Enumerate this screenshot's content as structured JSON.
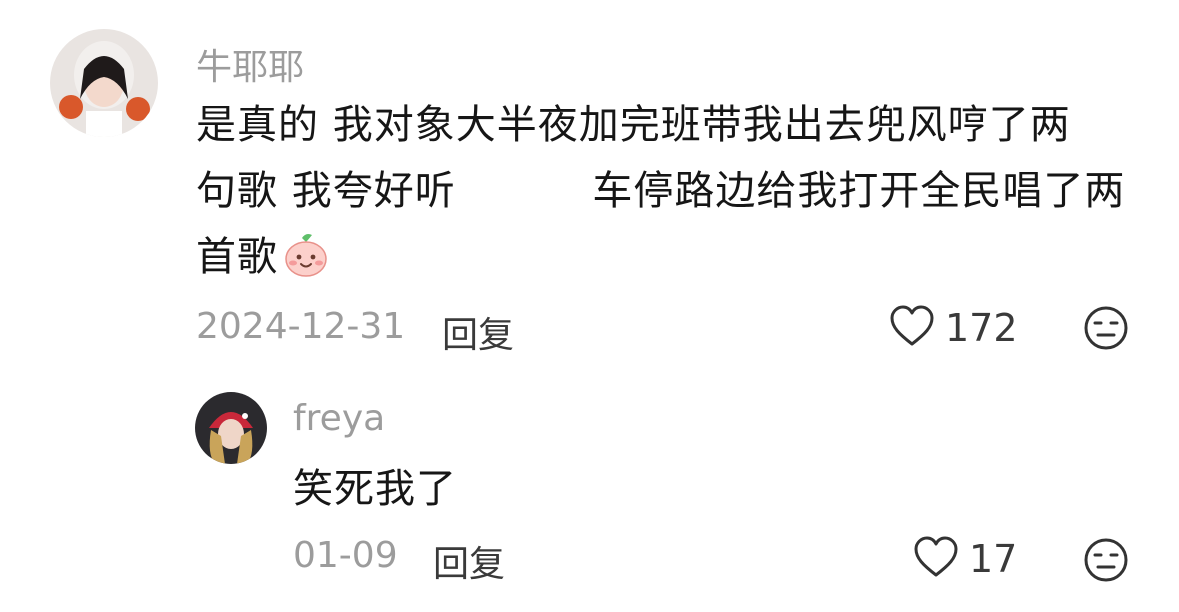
{
  "comments": [
    {
      "username": "牛耶耶",
      "text_lines": [
        "是真的 我对象大半夜加完班带我出去兜风哼了两",
        "句歌 我夸好听    车停路边给我打开全民唱了两",
        "首歌"
      ],
      "emoji": "peach-face-emoji",
      "date": "2024-12-31",
      "reply_label": "回复",
      "like_count": "172"
    },
    {
      "username": "freya",
      "text_lines": [
        "笑死我了"
      ],
      "date": "01-09",
      "reply_label": "回复",
      "like_count": "17"
    }
  ],
  "icons": {
    "like": "heart-outline-icon",
    "dislike": "meh-face-icon"
  },
  "colors": {
    "username": "#9c9c9c",
    "text": "#161616",
    "meta": "#9c9c9c",
    "action": "#3a3a3a"
  }
}
